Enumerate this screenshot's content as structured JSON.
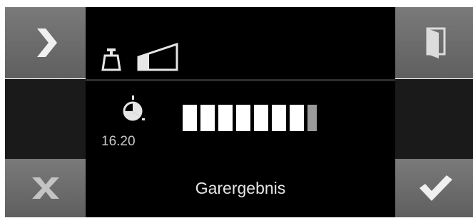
{
  "screen": {
    "timer_value": "16.20",
    "status_label": "Garergebnis",
    "result_bars": {
      "total": 8,
      "filled": 7
    }
  },
  "buttons": {
    "next": "chevron-right-icon",
    "exit": "door-icon",
    "cancel": "x-icon",
    "confirm": "checkmark-icon"
  },
  "colors": {
    "screen_bg": "#000000",
    "button_bg": "#6b6b6b",
    "bar_filled": "#ffffff",
    "bar_dim": "#9a9a9a"
  }
}
